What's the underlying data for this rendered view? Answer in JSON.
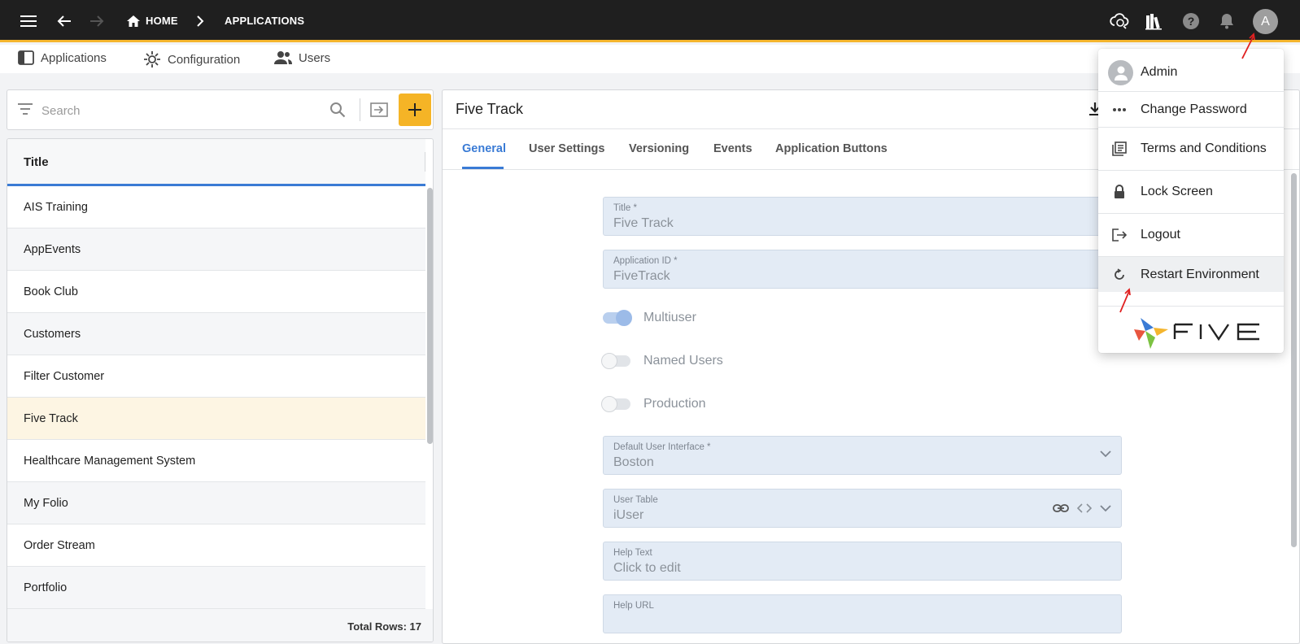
{
  "topbar": {
    "menu_icon": "hamburger-icon",
    "back_icon": "arrow-left-icon",
    "forward_icon": "arrow-right-icon",
    "breadcrumb": [
      "HOME",
      "APPLICATIONS"
    ],
    "avatar_letter": "A",
    "accent": "#f4b52e"
  },
  "subnav": {
    "items": [
      {
        "label": "Applications",
        "icon": "applications-icon"
      },
      {
        "label": "Configuration",
        "icon": "configuration-icon"
      },
      {
        "label": "Users",
        "icon": "users-icon"
      }
    ]
  },
  "list": {
    "search_placeholder": "Search",
    "column_header": "Title",
    "rows": [
      "AIS Training",
      "AppEvents",
      "Book Club",
      "Customers",
      "Filter Customer",
      "Five Track",
      "Healthcare Management System",
      "My Folio",
      "Order Stream",
      "Portfolio"
    ],
    "selected": "Five Track",
    "footer": "Total Rows: 17"
  },
  "detail": {
    "title": "Five Track",
    "tabs": [
      "General",
      "User Settings",
      "Versioning",
      "Events",
      "Application Buttons"
    ],
    "active_tab": "General",
    "fields": {
      "title_label": "Title *",
      "title_value": "Five Track",
      "appid_label": "Application ID *",
      "appid_value": "FiveTrack",
      "ui_label": "Default User Interface *",
      "ui_value": "Boston",
      "usertable_label": "User Table",
      "usertable_value": "iUser",
      "helptext_label": "Help Text",
      "helptext_value": "Click to edit",
      "helpurl_label": "Help URL"
    },
    "toggles": {
      "multiuser": "Multiuser",
      "named_users": "Named Users",
      "production": "Production"
    }
  },
  "menu": {
    "user": "Admin",
    "items": [
      "Change Password",
      "Terms and Conditions",
      "Lock Screen",
      "Logout",
      "Restart Environment"
    ],
    "brand": "FIVE"
  }
}
